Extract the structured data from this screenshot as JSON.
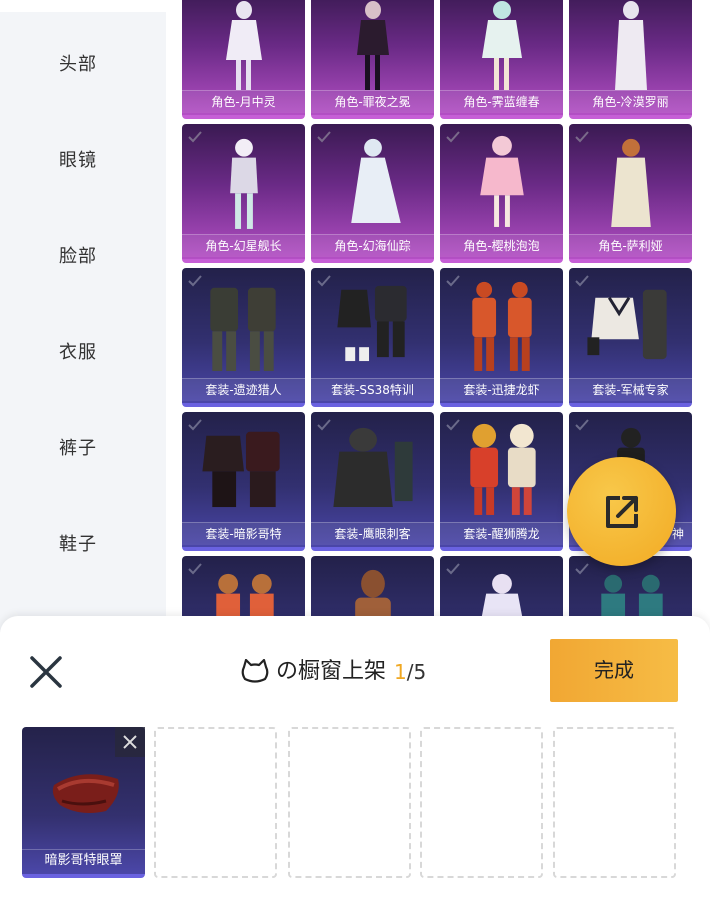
{
  "sidebar": {
    "items": [
      {
        "label": "头部"
      },
      {
        "label": "眼镜"
      },
      {
        "label": "脸部"
      },
      {
        "label": "衣服"
      },
      {
        "label": "裤子"
      },
      {
        "label": "鞋子"
      }
    ]
  },
  "grid": {
    "rows": [
      [
        {
          "label": "角色-月中灵",
          "type": "role"
        },
        {
          "label": "角色-罪夜之冕",
          "type": "role"
        },
        {
          "label": "角色-霁蓝缠春",
          "type": "role"
        },
        {
          "label": "角色-冷漠罗丽",
          "type": "role"
        }
      ],
      [
        {
          "label": "角色-幻星舰长",
          "type": "role"
        },
        {
          "label": "角色-幻海仙踪",
          "type": "role"
        },
        {
          "label": "角色-樱桃泡泡",
          "type": "role"
        },
        {
          "label": "角色-萨利娅",
          "type": "role"
        }
      ],
      [
        {
          "label": "套装-遗迹猎人",
          "type": "suit"
        },
        {
          "label": "套装-SS38特训",
          "type": "suit"
        },
        {
          "label": "套装-迅捷龙虾",
          "type": "suit"
        },
        {
          "label": "套装-军械专家",
          "type": "suit"
        }
      ],
      [
        {
          "label": "套装-暗影哥特",
          "type": "suit"
        },
        {
          "label": "套装-鹰眼刺客",
          "type": "suit"
        },
        {
          "label": "套装-醒狮腾龙",
          "type": "suit"
        },
        {
          "label": "神",
          "type": "suit"
        }
      ],
      [
        {
          "label": "",
          "type": "suit"
        },
        {
          "label": "",
          "type": "suit"
        },
        {
          "label": "",
          "type": "suit"
        },
        {
          "label": "",
          "type": "suit"
        }
      ]
    ]
  },
  "share_button": {
    "icon": "share-external-icon"
  },
  "panel": {
    "title": "の橱窗上架",
    "count_current": "1",
    "count_total": "/5",
    "done_label": "完成",
    "close_icon": "close-icon",
    "slots": [
      {
        "label": "暗影哥特眼罩",
        "filled": true
      },
      {
        "label": "",
        "filled": false
      },
      {
        "label": "",
        "filled": false
      },
      {
        "label": "",
        "filled": false
      },
      {
        "label": "",
        "filled": false
      }
    ]
  },
  "colors": {
    "accent": "#f2aa23",
    "role_card": "#b34fc4",
    "suit_card": "#4a46a8",
    "sidebar_bg": "#f3f5f8"
  }
}
